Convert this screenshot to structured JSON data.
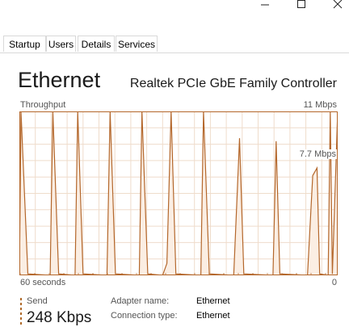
{
  "window": {
    "minimize_icon": "minimize-icon",
    "maximize_icon": "maximize-icon",
    "close_icon": "close-icon"
  },
  "tabs": [
    {
      "label": "Startup"
    },
    {
      "label": "Users"
    },
    {
      "label": "Details"
    },
    {
      "label": "Services"
    }
  ],
  "header": {
    "title": "Ethernet",
    "adapter": "Realtek PCIe GbE Family Controller"
  },
  "graph": {
    "label_top_left": "Throughput",
    "label_top_right": "11 Mbps",
    "label_mid": "7.7 Mbps",
    "label_bottom_left": "60 seconds",
    "label_bottom_right": "0",
    "line_color": "#b4672b",
    "fill_color": "#fbeee3",
    "grid_color": "#efdccb"
  },
  "chart_data": {
    "type": "area",
    "x_range": [
      60,
      0
    ],
    "ylim": [
      0,
      11
    ],
    "y_unit": "Mbps",
    "grid": true,
    "series": [
      {
        "values": [
          [
            60,
            0
          ],
          [
            59.7,
            11
          ],
          [
            58.4,
            0.1
          ],
          [
            54.2,
            0
          ],
          [
            53.7,
            11
          ],
          [
            52.6,
            0.1
          ],
          [
            49.5,
            0
          ],
          [
            49.0,
            11
          ],
          [
            48.0,
            0.1
          ],
          [
            43.5,
            0
          ],
          [
            42.9,
            11
          ],
          [
            41.9,
            0.1
          ],
          [
            37.4,
            0
          ],
          [
            36.9,
            11
          ],
          [
            35.8,
            0.1
          ],
          [
            33.0,
            0
          ],
          [
            32.2,
            0.8
          ],
          [
            31.4,
            11
          ],
          [
            30.5,
            0.1
          ],
          [
            25.8,
            0
          ],
          [
            25.3,
            11
          ],
          [
            24.2,
            0.1
          ],
          [
            19.6,
            0
          ],
          [
            18.5,
            9.2
          ],
          [
            17.7,
            0.1
          ],
          [
            12.2,
            0
          ],
          [
            11.6,
            9.0
          ],
          [
            10.9,
            0.1
          ],
          [
            5.7,
            0
          ],
          [
            4.7,
            6.7
          ],
          [
            3.9,
            7.2
          ],
          [
            3.4,
            0.1
          ],
          [
            1.8,
            0
          ],
          [
            1.4,
            11
          ],
          [
            1.0,
            0.1
          ],
          [
            0,
            11
          ]
        ]
      }
    ]
  },
  "stats": {
    "send_label": "Send",
    "send_value": "248 Kbps",
    "adapter_name_label": "Adapter name:",
    "adapter_name_value": "Ethernet",
    "connection_type_label": "Connection type:",
    "connection_type_value": "Ethernet"
  }
}
